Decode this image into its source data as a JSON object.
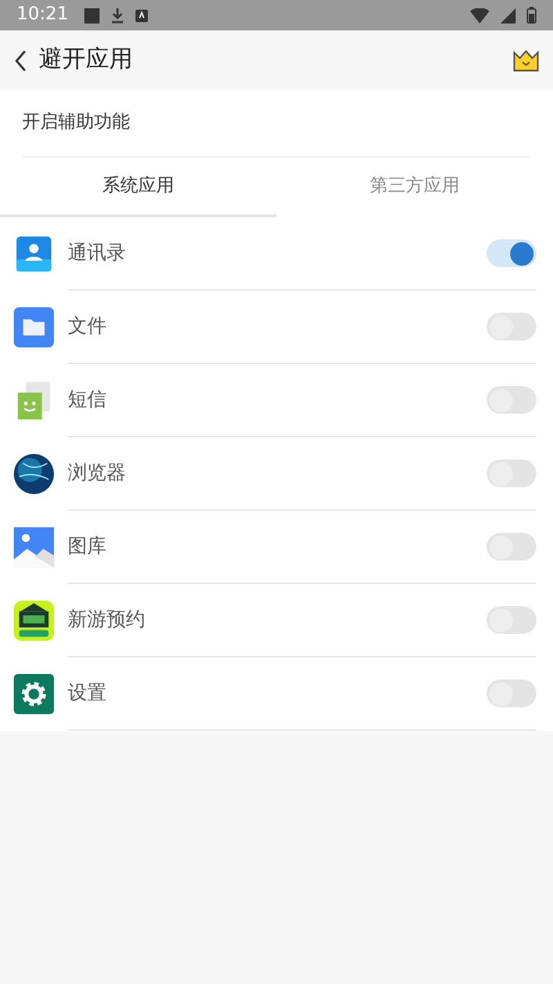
{
  "status_bar": {
    "time": "10:21"
  },
  "header": {
    "title": "避开应用"
  },
  "accessibility": {
    "label": "开启辅助功能"
  },
  "tabs": [
    {
      "label": "系统应用",
      "selected": true
    },
    {
      "label": "第三方应用",
      "selected": false
    }
  ],
  "apps": [
    {
      "name": "通讯录",
      "kind": "contacts",
      "on": true
    },
    {
      "name": "文件",
      "kind": "files",
      "on": false
    },
    {
      "name": "短信",
      "kind": "messages",
      "on": false
    },
    {
      "name": "浏览器",
      "kind": "browser",
      "on": false
    },
    {
      "name": "图库",
      "kind": "gallery",
      "on": false
    },
    {
      "name": "新游预约",
      "kind": "game",
      "on": false
    },
    {
      "name": "设置",
      "kind": "settings",
      "on": false
    }
  ]
}
